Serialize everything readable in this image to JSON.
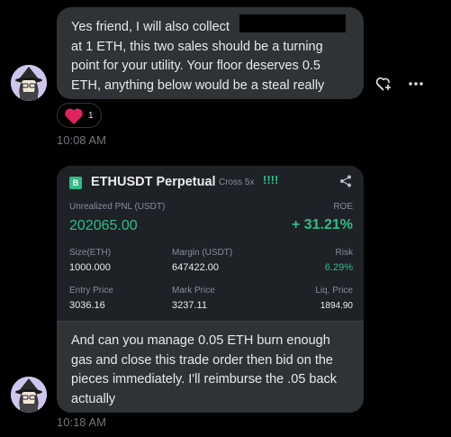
{
  "messages": [
    {
      "text_line1": "Yes friend,  I will also collect",
      "text_rest": "at 1 ETH,  this two sales should be a turning point for your utility. Your floor deserves 0.5 ETH,  anything below would be a steal really",
      "reaction": {
        "emoji": "heart",
        "count": "1"
      },
      "time": "10:08 AM"
    },
    {
      "text": "And can you manage 0.05 ETH burn enough gas and close this trade order then bid on the pieces immediately. I'll reimburse the .05 back actually",
      "time": "10:18 AM"
    }
  ],
  "trade_card": {
    "logo_letter": "B",
    "pair": "ETHUSDT Perpetual",
    "mode": "Cross 5x",
    "bars": "!!!!",
    "pnl_label": "Unrealized PNL (USDT)",
    "pnl_value": "202065.00",
    "roe_label": "ROE",
    "roe_value": "+ 31.21%",
    "size_label": "Size(ETH)",
    "size_value": "1000.000",
    "margin_label": "Margin (USDT)",
    "margin_value": "647422.00",
    "risk_label": "Risk",
    "risk_value": "6.29%",
    "entry_label": "Entry Price",
    "entry_value": "3036.16",
    "mark_label": "Mark Price",
    "mark_value": "3237.11",
    "liq_label": "Liq. Price",
    "liq_value": "1894.90"
  },
  "icons": [
    "add-reaction-icon",
    "more-icon",
    "share-icon",
    "avatar"
  ],
  "colors": {
    "bubble": "#2f3336",
    "green": "#2ebd85",
    "muted": "#71767b",
    "card": "#1e2126"
  }
}
